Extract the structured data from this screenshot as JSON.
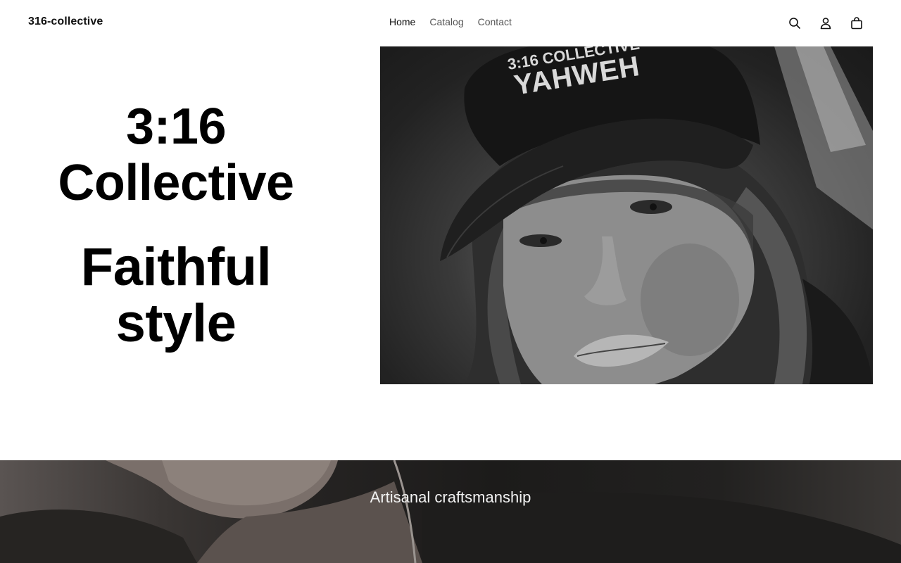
{
  "brand": {
    "name": "316-collective"
  },
  "nav": {
    "items": [
      {
        "label": "Home",
        "active": true
      },
      {
        "label": "Catalog",
        "active": false
      },
      {
        "label": "Contact",
        "active": false
      }
    ]
  },
  "header_icons": [
    "search-icon",
    "account-icon",
    "cart-icon"
  ],
  "hero": {
    "title": "3:16 Collective",
    "subtitle": "Faithful style",
    "image": {
      "cap_text_line1": "3:16 COLLECTIVE",
      "cap_text_line2": "YAHWEH"
    }
  },
  "band": {
    "title": "Artisanal craftsmanship"
  },
  "colors": {
    "text": "#111111",
    "nav_inactive": "#555555",
    "background": "#ffffff",
    "band_text": "#f2f2f2"
  }
}
